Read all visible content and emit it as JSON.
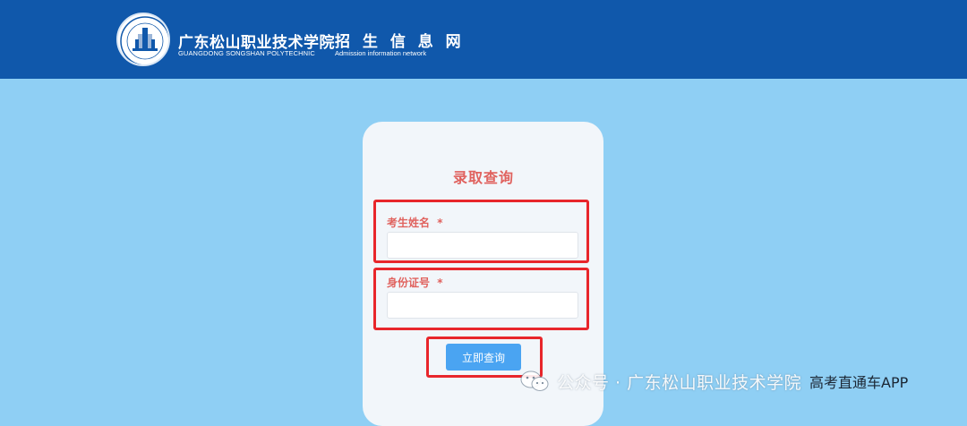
{
  "header": {
    "school_name_cn": "广东松山职业技术学院",
    "school_name_en": "GUANGDONG SONGSHAN POLYTECHNIC",
    "site_name_cn": "招 生 信 息 网",
    "site_name_en": "Admission information network",
    "logo_icon": "school-seal-icon",
    "background_color": "#1058ab"
  },
  "page": {
    "background_color": "#8fcff4"
  },
  "form": {
    "title": "录取查询",
    "name_label": "考生姓名",
    "name_required_mark": "*",
    "name_value": "",
    "id_label": "身份证号",
    "id_required_mark": "*",
    "id_value": "",
    "submit_label": "立即查询",
    "label_color": "#e0625e",
    "button_color": "#4aa4f2",
    "highlight_color": "#e8262b"
  },
  "watermark": {
    "icon": "wechat-icon",
    "text": "公众号 · 广东松山职业技术学院",
    "overlay_text": "高考直通车APP"
  }
}
